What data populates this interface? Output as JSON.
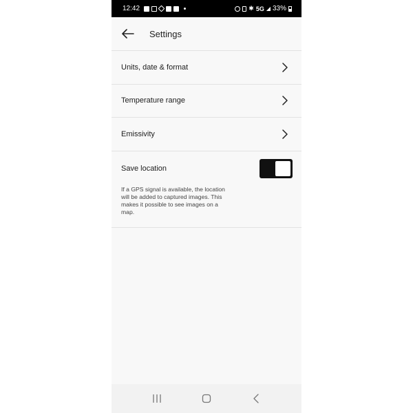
{
  "status_bar": {
    "time": "12:42",
    "network": "5G",
    "battery": "33%",
    "left_icons": [
      "teams-icon",
      "mail-icon",
      "nav-icon",
      "linkedin-icon",
      "linkedin-icon"
    ],
    "right_icons": [
      "alarm-icon",
      "vibrate-icon",
      "bluetooth-icon",
      "signal-icon",
      "battery-icon"
    ]
  },
  "app_bar": {
    "title": "Settings",
    "back_icon": "arrow-left-icon"
  },
  "settings": {
    "items": [
      {
        "label": "Units, date & format"
      },
      {
        "label": "Temperature range"
      },
      {
        "label": "Emissivity"
      }
    ],
    "save_location": {
      "label": "Save location",
      "enabled": true,
      "description": "If a GPS signal is available, the location will be added to captured images. This makes it possible to see images on a map."
    }
  },
  "nav_bar": {
    "icons": [
      "recent-apps-icon",
      "home-icon",
      "back-icon"
    ]
  }
}
